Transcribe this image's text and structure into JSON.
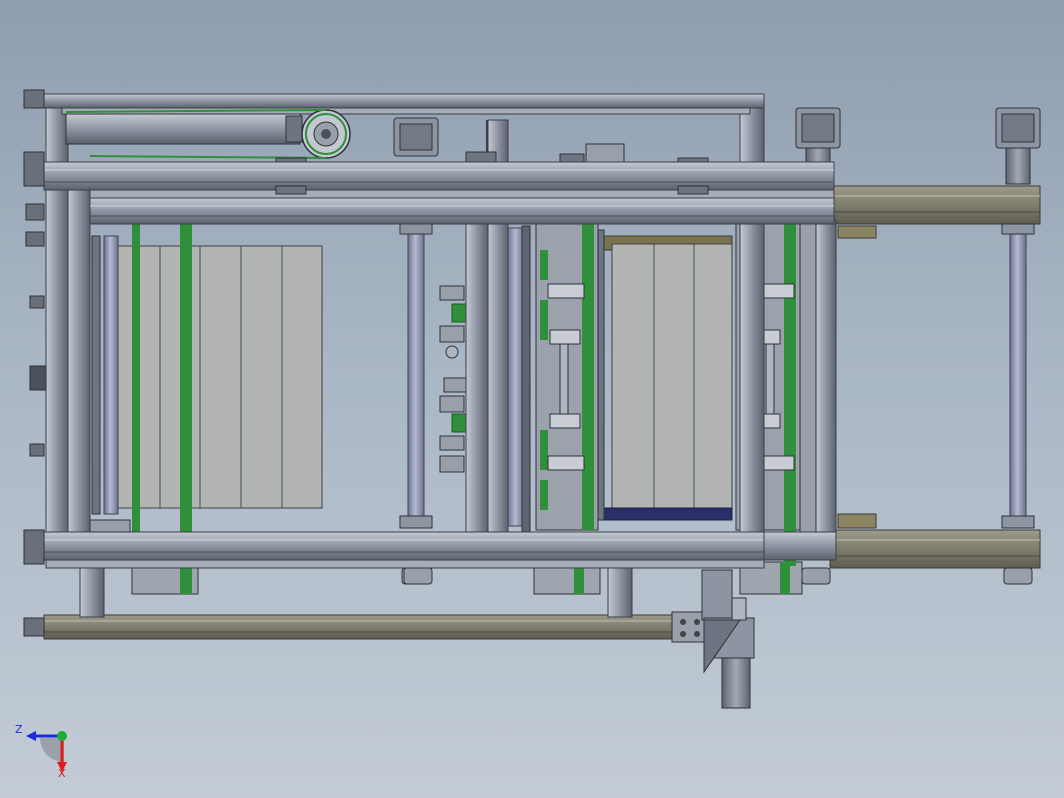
{
  "viewport": {
    "background_top": "#8e9db0",
    "background_bottom": "#c3ccd6"
  },
  "colors": {
    "frame": "#8c94a3",
    "frame_dark": "#4a5058",
    "frame_light": "#b7bec9",
    "belt_green": "#2f8f3a",
    "panel": "#b2b4b2",
    "roller": "#9aa0b8",
    "olive": "#7a7350",
    "navy": "#2a2f6a"
  },
  "triad": {
    "z_label": "Z",
    "x_label": "X",
    "z_color": "#1a2be0",
    "x_color": "#e01a1a",
    "y_color": "#19b030"
  }
}
